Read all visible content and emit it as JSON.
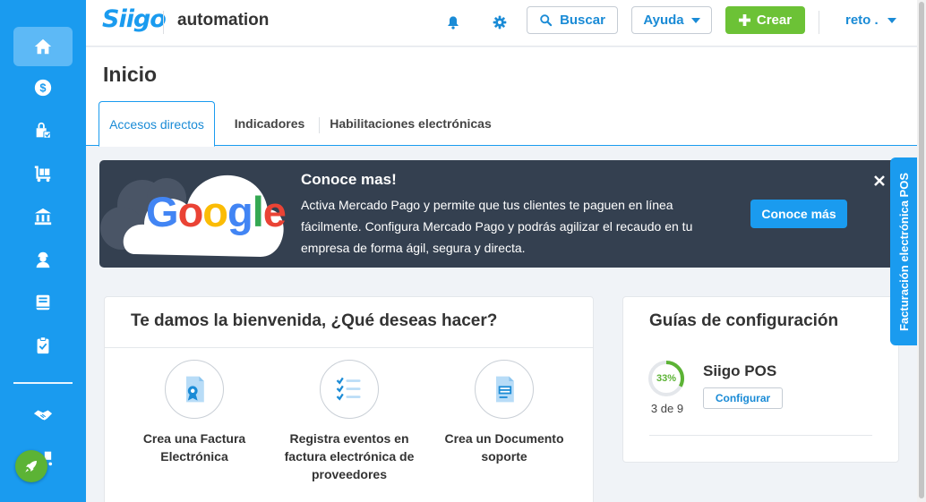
{
  "sidebar": {
    "items": [
      {
        "icon": "home-icon"
      },
      {
        "icon": "dollar-icon"
      },
      {
        "icon": "shopping-bag-icon"
      },
      {
        "icon": "cart-icon"
      },
      {
        "icon": "bank-icon"
      },
      {
        "icon": "worker-icon"
      },
      {
        "icon": "book-icon"
      },
      {
        "icon": "clipboard-check-icon"
      },
      {
        "icon": "handshake-icon"
      },
      {
        "icon": "store-icon"
      }
    ]
  },
  "topbar": {
    "logo": "Siigo",
    "company": "automation",
    "search_label": "Buscar",
    "help_label": "Ayuda",
    "create_label": "Crear",
    "user_label": "reto ."
  },
  "page": {
    "title": "Inicio",
    "tabs": [
      {
        "label": "Accesos directos",
        "active": true
      },
      {
        "label": "Indicadores",
        "active": false
      },
      {
        "label": "Habilitaciones electrónicas",
        "active": false
      }
    ]
  },
  "banner": {
    "brand": "Google",
    "title": "Conoce mas!",
    "text": "Activa Mercado Pago y permite que tus clientes te paguen en línea fácilmente. Configura Mercado Pago y podrás agilizar el recaudo en tu empresa de forma ágil, segura y directa.",
    "button_label": "Conoce más"
  },
  "welcome": {
    "title": "Te damos la bienvenida, ¿Qué deseas hacer?",
    "actions": [
      {
        "label": "Crea una Factura Electrónica",
        "icon": "invoice-icon"
      },
      {
        "label": "Registra eventos en factura electrónica de proveedores",
        "icon": "checklist-icon"
      },
      {
        "label": "Crea un Documento soporte",
        "icon": "document-icon"
      }
    ]
  },
  "guides": {
    "title": "Guías de configuración",
    "item": {
      "name": "Siigo POS",
      "progress_label": "33%",
      "progress": 0.33,
      "count": "3 de 9",
      "button_label": "Configurar"
    }
  },
  "side_tab": {
    "label": "Facturación electrónica POS"
  },
  "colors": {
    "primary": "#1a9bef",
    "success": "#6cc236",
    "banner_bg": "#344050"
  }
}
